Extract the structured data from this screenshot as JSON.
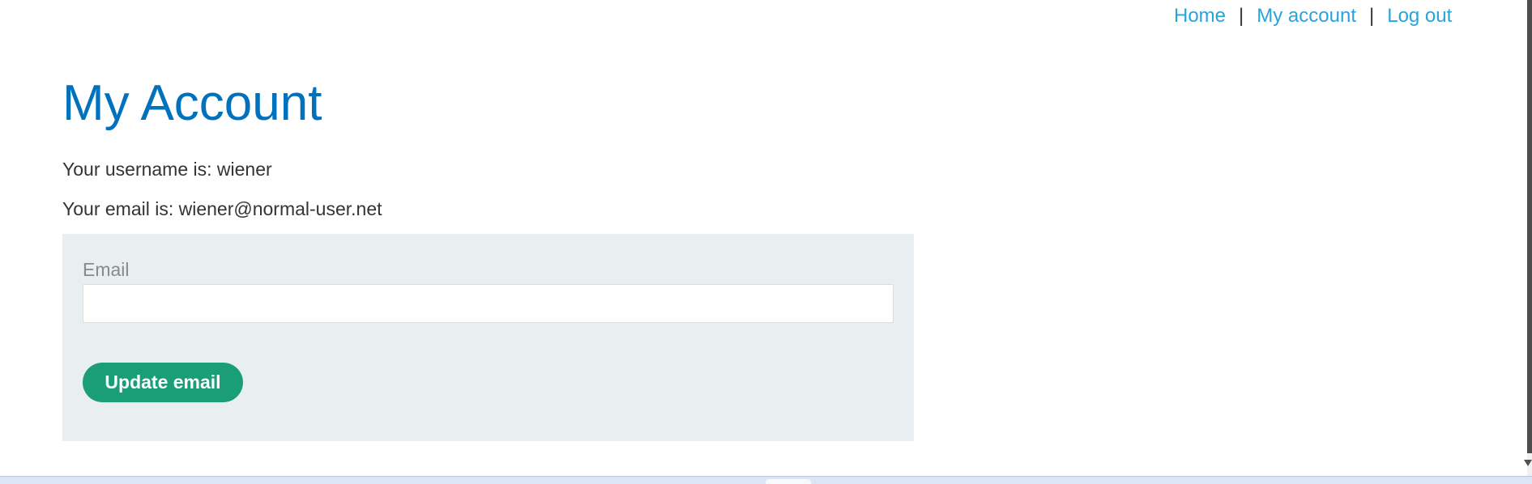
{
  "nav": {
    "home_label": "Home",
    "separator": "|",
    "my_account_label": "My account",
    "log_out_label": "Log out"
  },
  "page": {
    "title": "My Account",
    "username_text": "Your username is: wiener",
    "email_text": "Your email is: wiener@normal-user.net"
  },
  "form": {
    "email_label": "Email",
    "email_value": "",
    "submit_label": "Update email"
  },
  "colors": {
    "link": "#29a3dc",
    "title": "#0071bc",
    "button": "#1a9e78",
    "panel": "#e9eef1"
  }
}
